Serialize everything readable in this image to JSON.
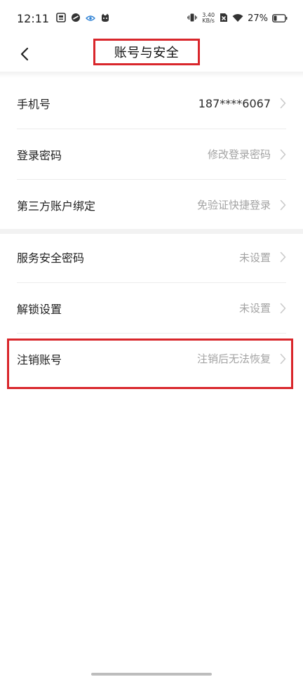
{
  "status_bar": {
    "time": "12:11",
    "net_speed_value": "3.40",
    "net_speed_unit": "KB/s",
    "battery_percent": "27%",
    "battery_level": 0.27
  },
  "nav": {
    "title": "账号与安全"
  },
  "sections": [
    {
      "rows": [
        {
          "label": "手机号",
          "value": "187****6067"
        },
        {
          "label": "登录密码",
          "value": "修改登录密码"
        },
        {
          "label": "第三方账户绑定",
          "value": "免验证快捷登录"
        }
      ]
    },
    {
      "rows": [
        {
          "label": "服务安全密码",
          "value": "未设置"
        },
        {
          "label": "解锁设置",
          "value": "未设置"
        },
        {
          "label": "注销账号",
          "value": "注销后无法恢复"
        }
      ]
    }
  ],
  "colors": {
    "highlight": "#d9262b",
    "muted_text": "#a3a3a3",
    "primary_text": "#1f1f1f"
  }
}
